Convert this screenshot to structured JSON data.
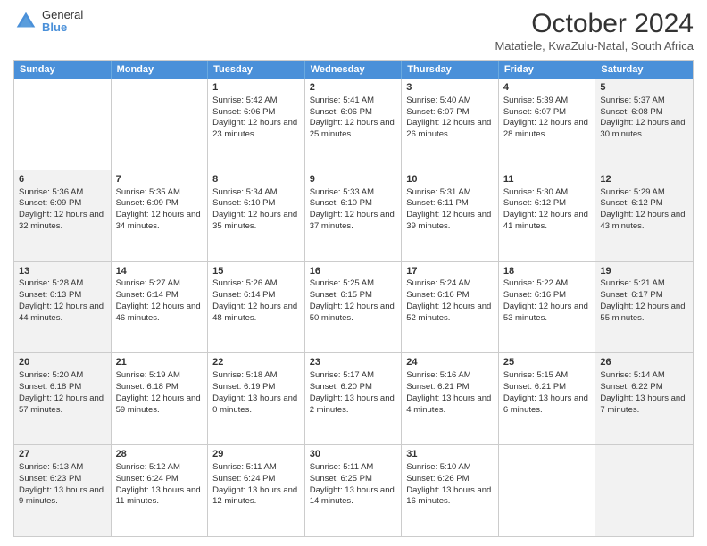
{
  "logo": {
    "general": "General",
    "blue": "Blue"
  },
  "title": "October 2024",
  "subtitle": "Matatiele, KwaZulu-Natal, South Africa",
  "days": [
    "Sunday",
    "Monday",
    "Tuesday",
    "Wednesday",
    "Thursday",
    "Friday",
    "Saturday"
  ],
  "weeks": [
    [
      {
        "day": "",
        "info": "",
        "shaded": false
      },
      {
        "day": "",
        "info": "",
        "shaded": false
      },
      {
        "day": "1",
        "info": "Sunrise: 5:42 AM\nSunset: 6:06 PM\nDaylight: 12 hours and 23 minutes.",
        "shaded": false
      },
      {
        "day": "2",
        "info": "Sunrise: 5:41 AM\nSunset: 6:06 PM\nDaylight: 12 hours and 25 minutes.",
        "shaded": false
      },
      {
        "day": "3",
        "info": "Sunrise: 5:40 AM\nSunset: 6:07 PM\nDaylight: 12 hours and 26 minutes.",
        "shaded": false
      },
      {
        "day": "4",
        "info": "Sunrise: 5:39 AM\nSunset: 6:07 PM\nDaylight: 12 hours and 28 minutes.",
        "shaded": false
      },
      {
        "day": "5",
        "info": "Sunrise: 5:37 AM\nSunset: 6:08 PM\nDaylight: 12 hours and 30 minutes.",
        "shaded": true
      }
    ],
    [
      {
        "day": "6",
        "info": "Sunrise: 5:36 AM\nSunset: 6:09 PM\nDaylight: 12 hours and 32 minutes.",
        "shaded": true
      },
      {
        "day": "7",
        "info": "Sunrise: 5:35 AM\nSunset: 6:09 PM\nDaylight: 12 hours and 34 minutes.",
        "shaded": false
      },
      {
        "day": "8",
        "info": "Sunrise: 5:34 AM\nSunset: 6:10 PM\nDaylight: 12 hours and 35 minutes.",
        "shaded": false
      },
      {
        "day": "9",
        "info": "Sunrise: 5:33 AM\nSunset: 6:10 PM\nDaylight: 12 hours and 37 minutes.",
        "shaded": false
      },
      {
        "day": "10",
        "info": "Sunrise: 5:31 AM\nSunset: 6:11 PM\nDaylight: 12 hours and 39 minutes.",
        "shaded": false
      },
      {
        "day": "11",
        "info": "Sunrise: 5:30 AM\nSunset: 6:12 PM\nDaylight: 12 hours and 41 minutes.",
        "shaded": false
      },
      {
        "day": "12",
        "info": "Sunrise: 5:29 AM\nSunset: 6:12 PM\nDaylight: 12 hours and 43 minutes.",
        "shaded": true
      }
    ],
    [
      {
        "day": "13",
        "info": "Sunrise: 5:28 AM\nSunset: 6:13 PM\nDaylight: 12 hours and 44 minutes.",
        "shaded": true
      },
      {
        "day": "14",
        "info": "Sunrise: 5:27 AM\nSunset: 6:14 PM\nDaylight: 12 hours and 46 minutes.",
        "shaded": false
      },
      {
        "day": "15",
        "info": "Sunrise: 5:26 AM\nSunset: 6:14 PM\nDaylight: 12 hours and 48 minutes.",
        "shaded": false
      },
      {
        "day": "16",
        "info": "Sunrise: 5:25 AM\nSunset: 6:15 PM\nDaylight: 12 hours and 50 minutes.",
        "shaded": false
      },
      {
        "day": "17",
        "info": "Sunrise: 5:24 AM\nSunset: 6:16 PM\nDaylight: 12 hours and 52 minutes.",
        "shaded": false
      },
      {
        "day": "18",
        "info": "Sunrise: 5:22 AM\nSunset: 6:16 PM\nDaylight: 12 hours and 53 minutes.",
        "shaded": false
      },
      {
        "day": "19",
        "info": "Sunrise: 5:21 AM\nSunset: 6:17 PM\nDaylight: 12 hours and 55 minutes.",
        "shaded": true
      }
    ],
    [
      {
        "day": "20",
        "info": "Sunrise: 5:20 AM\nSunset: 6:18 PM\nDaylight: 12 hours and 57 minutes.",
        "shaded": true
      },
      {
        "day": "21",
        "info": "Sunrise: 5:19 AM\nSunset: 6:18 PM\nDaylight: 12 hours and 59 minutes.",
        "shaded": false
      },
      {
        "day": "22",
        "info": "Sunrise: 5:18 AM\nSunset: 6:19 PM\nDaylight: 13 hours and 0 minutes.",
        "shaded": false
      },
      {
        "day": "23",
        "info": "Sunrise: 5:17 AM\nSunset: 6:20 PM\nDaylight: 13 hours and 2 minutes.",
        "shaded": false
      },
      {
        "day": "24",
        "info": "Sunrise: 5:16 AM\nSunset: 6:21 PM\nDaylight: 13 hours and 4 minutes.",
        "shaded": false
      },
      {
        "day": "25",
        "info": "Sunrise: 5:15 AM\nSunset: 6:21 PM\nDaylight: 13 hours and 6 minutes.",
        "shaded": false
      },
      {
        "day": "26",
        "info": "Sunrise: 5:14 AM\nSunset: 6:22 PM\nDaylight: 13 hours and 7 minutes.",
        "shaded": true
      }
    ],
    [
      {
        "day": "27",
        "info": "Sunrise: 5:13 AM\nSunset: 6:23 PM\nDaylight: 13 hours and 9 minutes.",
        "shaded": true
      },
      {
        "day": "28",
        "info": "Sunrise: 5:12 AM\nSunset: 6:24 PM\nDaylight: 13 hours and 11 minutes.",
        "shaded": false
      },
      {
        "day": "29",
        "info": "Sunrise: 5:11 AM\nSunset: 6:24 PM\nDaylight: 13 hours and 12 minutes.",
        "shaded": false
      },
      {
        "day": "30",
        "info": "Sunrise: 5:11 AM\nSunset: 6:25 PM\nDaylight: 13 hours and 14 minutes.",
        "shaded": false
      },
      {
        "day": "31",
        "info": "Sunrise: 5:10 AM\nSunset: 6:26 PM\nDaylight: 13 hours and 16 minutes.",
        "shaded": false
      },
      {
        "day": "",
        "info": "",
        "shaded": false
      },
      {
        "day": "",
        "info": "",
        "shaded": true
      }
    ]
  ]
}
